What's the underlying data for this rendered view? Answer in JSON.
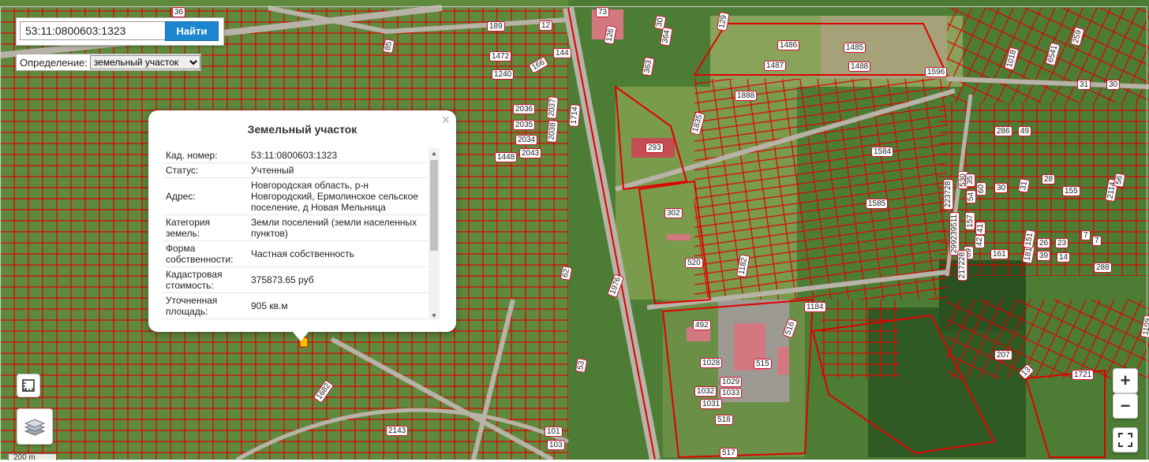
{
  "search": {
    "value": "53:11:0800603:1323",
    "button_label": "Найти"
  },
  "definition": {
    "label": "Определение:",
    "selected": "земельный участок"
  },
  "popup": {
    "title": "Земельный участок",
    "close_icon": "×",
    "rows": [
      {
        "key": "Кад. номер:",
        "value": "53:11:0800603:1323"
      },
      {
        "key": "Статус:",
        "value": "Учтенный"
      },
      {
        "key": "Адрес:",
        "value": "Новгородская область, р-н Новгородский, Ермолинское сельское поселение, д Новая Мельница"
      },
      {
        "key": "Категория земель:",
        "value": "Земли поселений (земли населенных пунктов)"
      },
      {
        "key": "Форма собственности:",
        "value": "Частная собственность"
      },
      {
        "key": "Кадастровая стоимость:",
        "value": "375873.65 руб"
      },
      {
        "key": "Уточненная площадь:",
        "value": "905 кв.м"
      }
    ]
  },
  "map": {
    "plot_labels": [
      "36",
      "73",
      "189",
      "12",
      "126",
      "30",
      "364",
      "129",
      "85",
      "1472",
      "144",
      "166",
      "1240",
      "1486",
      "1485",
      "1487",
      "1488",
      "1596",
      "363",
      "2036",
      "2035",
      "2034",
      "2043",
      "1448",
      "2037",
      "2038",
      "1714",
      "1888",
      "293",
      "1835",
      "1584",
      "1585",
      "302",
      "520",
      "1182",
      "62",
      "1976",
      "1184",
      "492",
      "516",
      "1028",
      "515",
      "1029",
      "1032",
      "1033",
      "1031",
      "518",
      "1682",
      "2143",
      "53",
      "101",
      "103",
      "517",
      "223728",
      "530",
      "35",
      "54",
      "60",
      "299239511",
      "157",
      "41",
      "42",
      "69",
      "217228",
      "161",
      "30",
      "31",
      "28",
      "26",
      "23",
      "181",
      "151",
      "39",
      "14",
      "155",
      "2114",
      "56",
      "286",
      "49",
      "7",
      "288",
      "207",
      "13",
      "1721",
      "1018",
      "6541",
      "259",
      "30",
      "31",
      "7",
      "1199"
    ],
    "imagery_colors": {
      "vegetation": "#4d7d35",
      "field": "#7a9a4c",
      "parcel_line": "#e00000",
      "road": "#b8b3a8"
    }
  },
  "controls": {
    "zoom_in": "+",
    "zoom_out": "−",
    "scale_text": "200 m",
    "icons": {
      "measure": "ruler-icon",
      "layers": "layers-icon",
      "fullscreen": "fullscreen-icon"
    }
  }
}
